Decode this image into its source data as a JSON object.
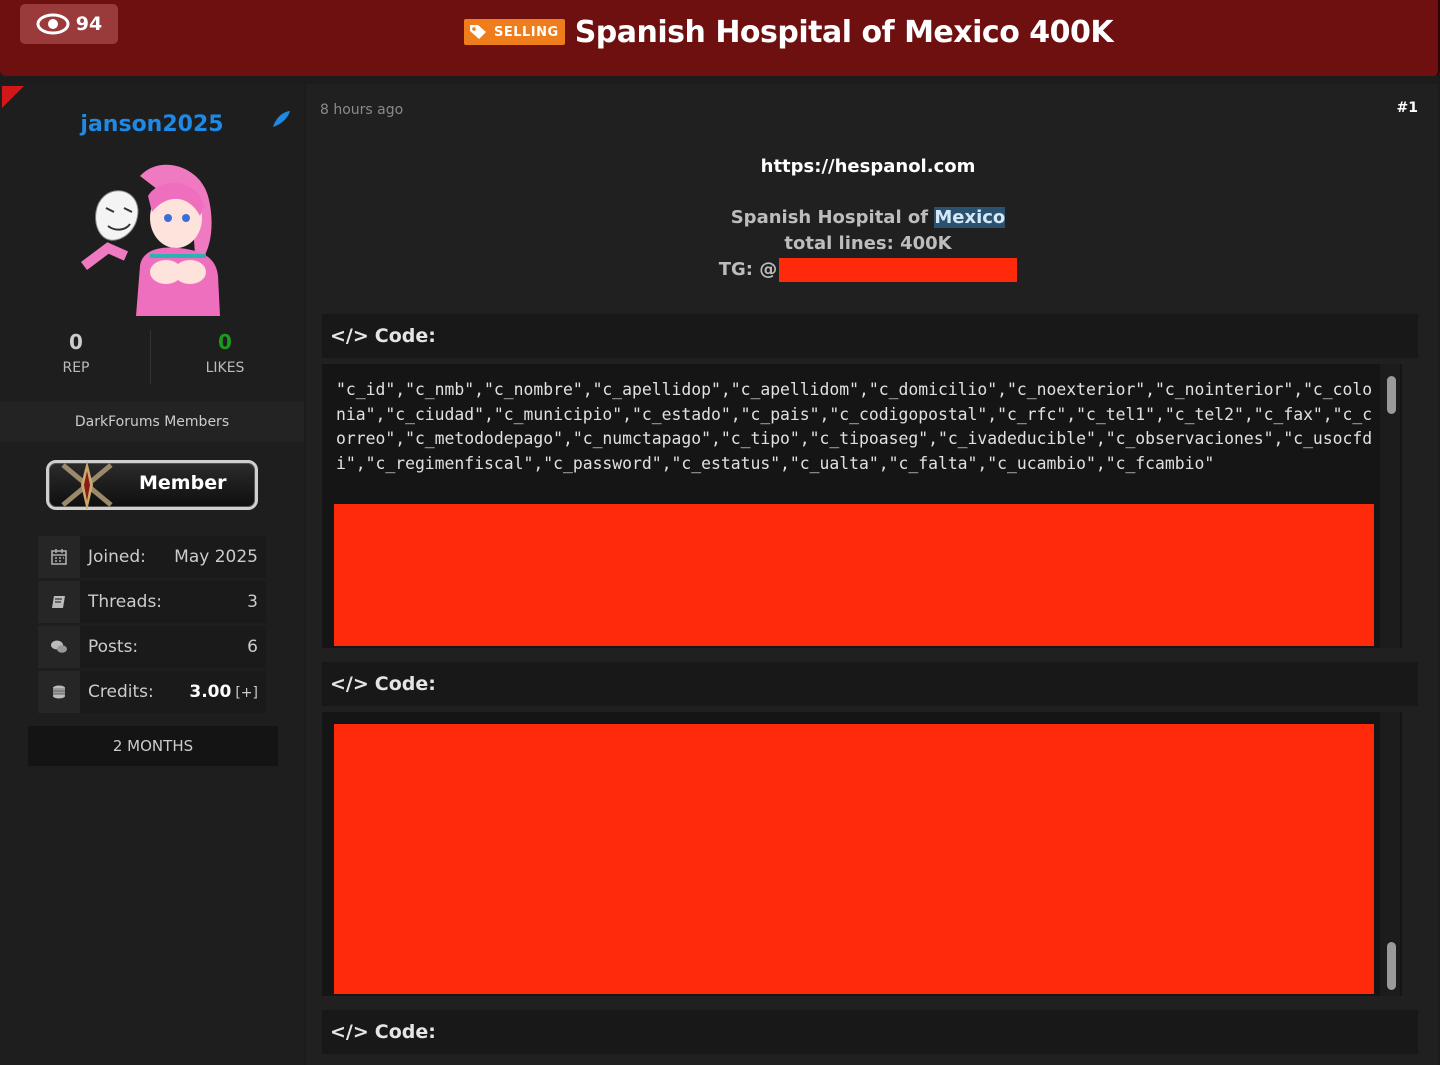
{
  "header": {
    "view_count": "94",
    "tag_label": "SELLING",
    "title": "Spanish Hospital of Mexico 400K"
  },
  "user": {
    "username": "janson2025",
    "rep_value": "0",
    "rep_label": "REP",
    "likes_value": "0",
    "likes_label": "LIKES",
    "group": "DarkForums Members",
    "badge_label": "Member",
    "info": [
      {
        "label": "Joined:",
        "value": "May 2025",
        "icon": "calendar-icon"
      },
      {
        "label": "Threads:",
        "value": "3",
        "icon": "threads-icon"
      },
      {
        "label": "Posts:",
        "value": "6",
        "icon": "posts-icon"
      },
      {
        "label": "Credits:",
        "value": "3.00",
        "extra": "[+]",
        "icon": "credits-icon"
      }
    ],
    "duration": "2 MONTHS"
  },
  "post": {
    "timestamp": "8 hours ago",
    "number": "#1",
    "link": "https://hespanol.com",
    "line1_prefix": "Spanish Hospital of ",
    "line1_highlight": "Mexico",
    "line2": "total lines: 400K",
    "tg_prefix": "TG: @",
    "code_label": "Code:",
    "code1_text": "\"c_id\",\"c_nmb\",\"c_nombre\",\"c_apellidop\",\"c_apellidom\",\"c_domicilio\",\"c_noexterior\",\"c_nointerior\",\"c_colonia\",\"c_ciudad\",\"c_municipio\",\"c_estado\",\"c_pais\",\"c_codigopostal\",\"c_rfc\",\"c_tel1\",\"c_tel2\",\"c_fax\",\"c_correo\",\"c_metododepago\",\"c_numctapago\",\"c_tipo\",\"c_tipoaseg\",\"c_ivadeducible\",\"c_observaciones\",\"c_usocfdi\",\"c_regimenfiscal\",\"c_password\",\"c_estatus\",\"c_ualta\",\"c_falta\",\"c_ucambio\",\"c_fcambio\""
  },
  "colors": {
    "header_bg": "#6e0f10",
    "username": "#1f8ae6",
    "likes": "#1c9a1c",
    "tag_bg": "#ef7d1c",
    "redaction": "#ff2a0c"
  }
}
